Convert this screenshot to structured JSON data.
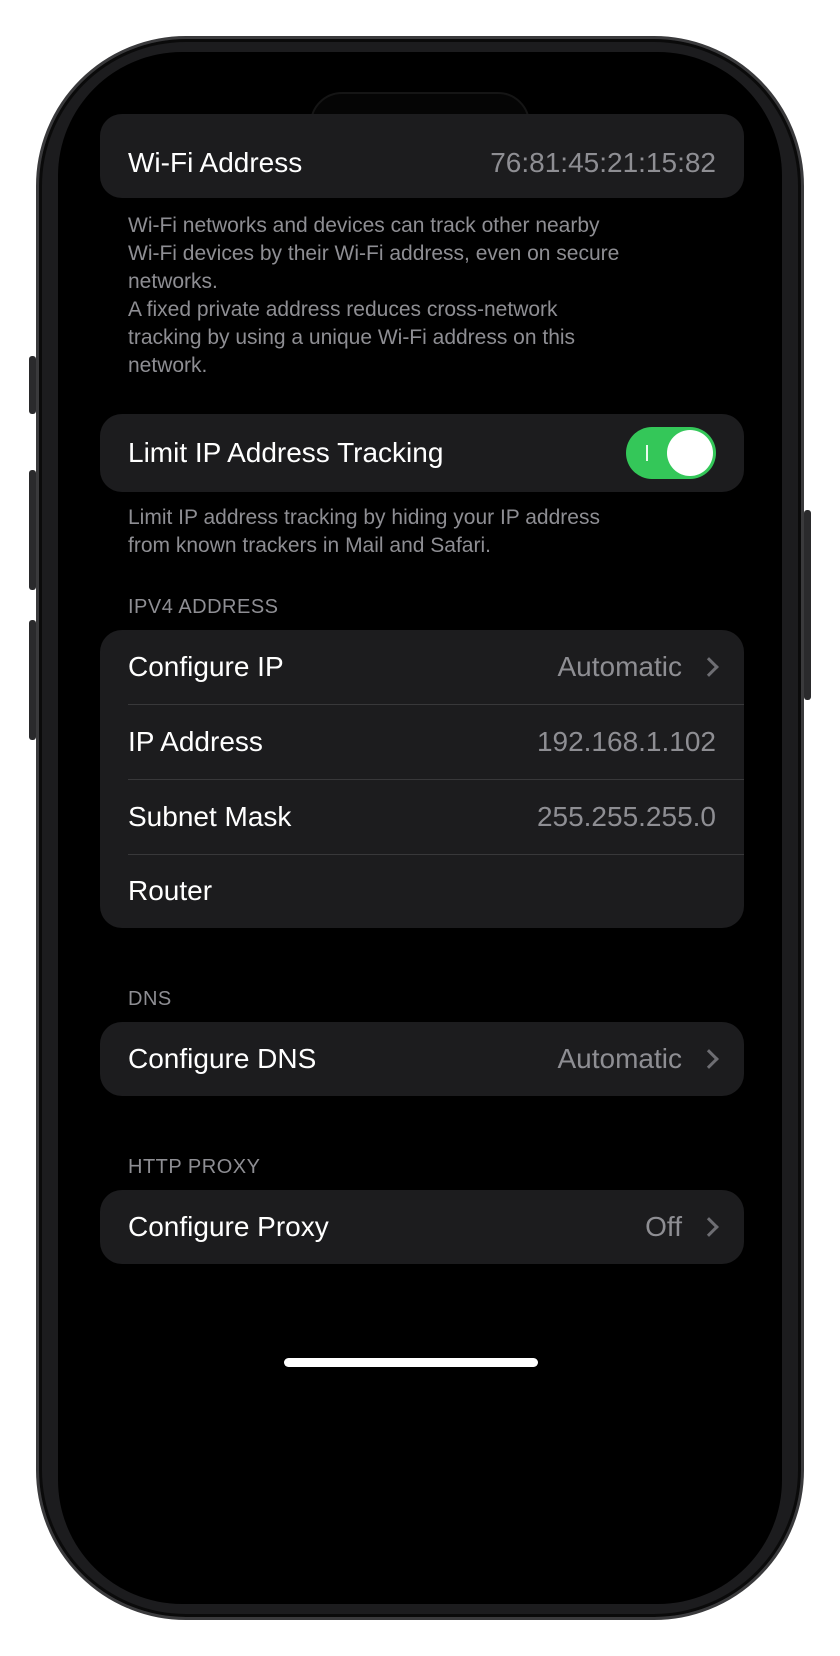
{
  "wifi_address": {
    "label": "Wi-Fi Address",
    "value": "76:81:45:21:15:82"
  },
  "wifi_footnote": [
    "Wi-Fi networks and devices can track other nearby",
    "Wi-Fi devices by their Wi-Fi address, even on secure",
    "networks.",
    "A fixed private address reduces cross-network",
    "tracking by using a unique Wi-Fi address on this",
    "network."
  ],
  "limit_ip": {
    "label": "Limit IP Address Tracking",
    "toggle_on": true
  },
  "limit_ip_footnote": [
    "Limit IP address tracking by hiding your IP address",
    "from known trackers in Mail and Safari."
  ],
  "ipv4": {
    "header": "IPV4 ADDRESS",
    "rows": [
      {
        "label": "Configure IP",
        "value": "Automatic"
      },
      {
        "label": "IP Address",
        "value": "192.168.1.102"
      },
      {
        "label": "Subnet Mask",
        "value": "255.255.255.0"
      },
      {
        "label": "Router",
        "value": ""
      }
    ]
  },
  "dns": {
    "header": "DNS",
    "row": {
      "label": "Configure DNS",
      "value": "Automatic"
    }
  },
  "proxy": {
    "header": "HTTP PROXY",
    "row": {
      "label": "Configure Proxy",
      "value": "Off"
    }
  },
  "colors": {
    "toggle_on": "#34c759",
    "background": "#000000",
    "cell": "#1c1c1e",
    "secondary_text": "#8e8e93"
  }
}
